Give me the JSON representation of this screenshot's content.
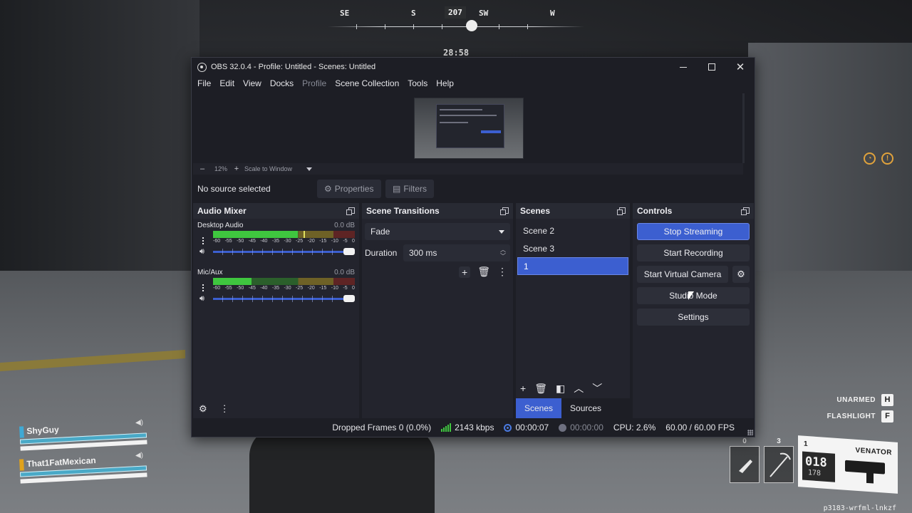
{
  "game": {
    "compass": {
      "labels": [
        "SE",
        "S",
        "SW",
        "W"
      ],
      "heading": "207"
    },
    "timer": "28:58",
    "squad": [
      {
        "name": "ShyGuy",
        "color": "#3fa9d4"
      },
      {
        "name": "That1FatMexican",
        "color": "#e0a21c"
      }
    ],
    "keys": [
      {
        "label": "UNARMED",
        "key": "H"
      },
      {
        "label": "FLASHLIGHT",
        "key": "F"
      }
    ],
    "slots": [
      {
        "number": "0",
        "icon": "knife-icon"
      },
      {
        "number": "3",
        "icon": "pickaxe-icon"
      }
    ],
    "weapon": {
      "slot": "1",
      "name": "VENATOR",
      "ammo": "018",
      "reserve": "178"
    },
    "watermark": "p3183-wrfml-lnkzf"
  },
  "obs": {
    "window_title": "OBS 32.0.4 - Profile: Untitled - Scenes: Untitled",
    "menu": [
      "File",
      "Edit",
      "View",
      "Docks",
      "Profile",
      "Scene Collection",
      "Tools",
      "Help"
    ],
    "menu_disabled": [
      "Profile"
    ],
    "zoom": {
      "minus": "–",
      "level": "12%",
      "plus": "+",
      "mode": "Scale to Window"
    },
    "source_bar": {
      "no_source": "No source selected",
      "properties": "Properties",
      "filters": "Filters"
    },
    "audio_mixer": {
      "title": "Audio Mixer",
      "channels": [
        {
          "name": "Desktop Audio",
          "db": "0.0 dB",
          "level_fraction": 0.6
        },
        {
          "name": "Mic/Aux",
          "db": "0.0 dB",
          "level_fraction": 0.27
        }
      ],
      "scale": [
        "-60",
        "-55",
        "-50",
        "-45",
        "-40",
        "-35",
        "-30",
        "-25",
        "-20",
        "-15",
        "-10",
        "-5",
        "0"
      ]
    },
    "transitions": {
      "title": "Scene Transitions",
      "selected": "Fade",
      "duration_label": "Duration",
      "duration_value": "300 ms"
    },
    "scenes": {
      "title": "Scenes",
      "items": [
        "Scene 2",
        "Scene 3",
        "1"
      ],
      "active": "1",
      "tabs": [
        "Scenes",
        "Sources"
      ],
      "active_tab": "Scenes"
    },
    "controls": {
      "title": "Controls",
      "stop_streaming": "Stop Streaming",
      "start_recording": "Start Recording",
      "start_virtual_camera": "Start Virtual Camera",
      "studio_mode": "Studio Mode",
      "settings": "Settings"
    },
    "status": {
      "dropped_frames": "Dropped Frames 0 (0.0%)",
      "bitrate": "2143 kbps",
      "stream_time": "00:00:07",
      "record_time": "00:00:00",
      "cpu": "CPU: 2.6%",
      "fps": "60.00 / 60.00 FPS"
    },
    "accent_color": "#3c5fd0"
  }
}
